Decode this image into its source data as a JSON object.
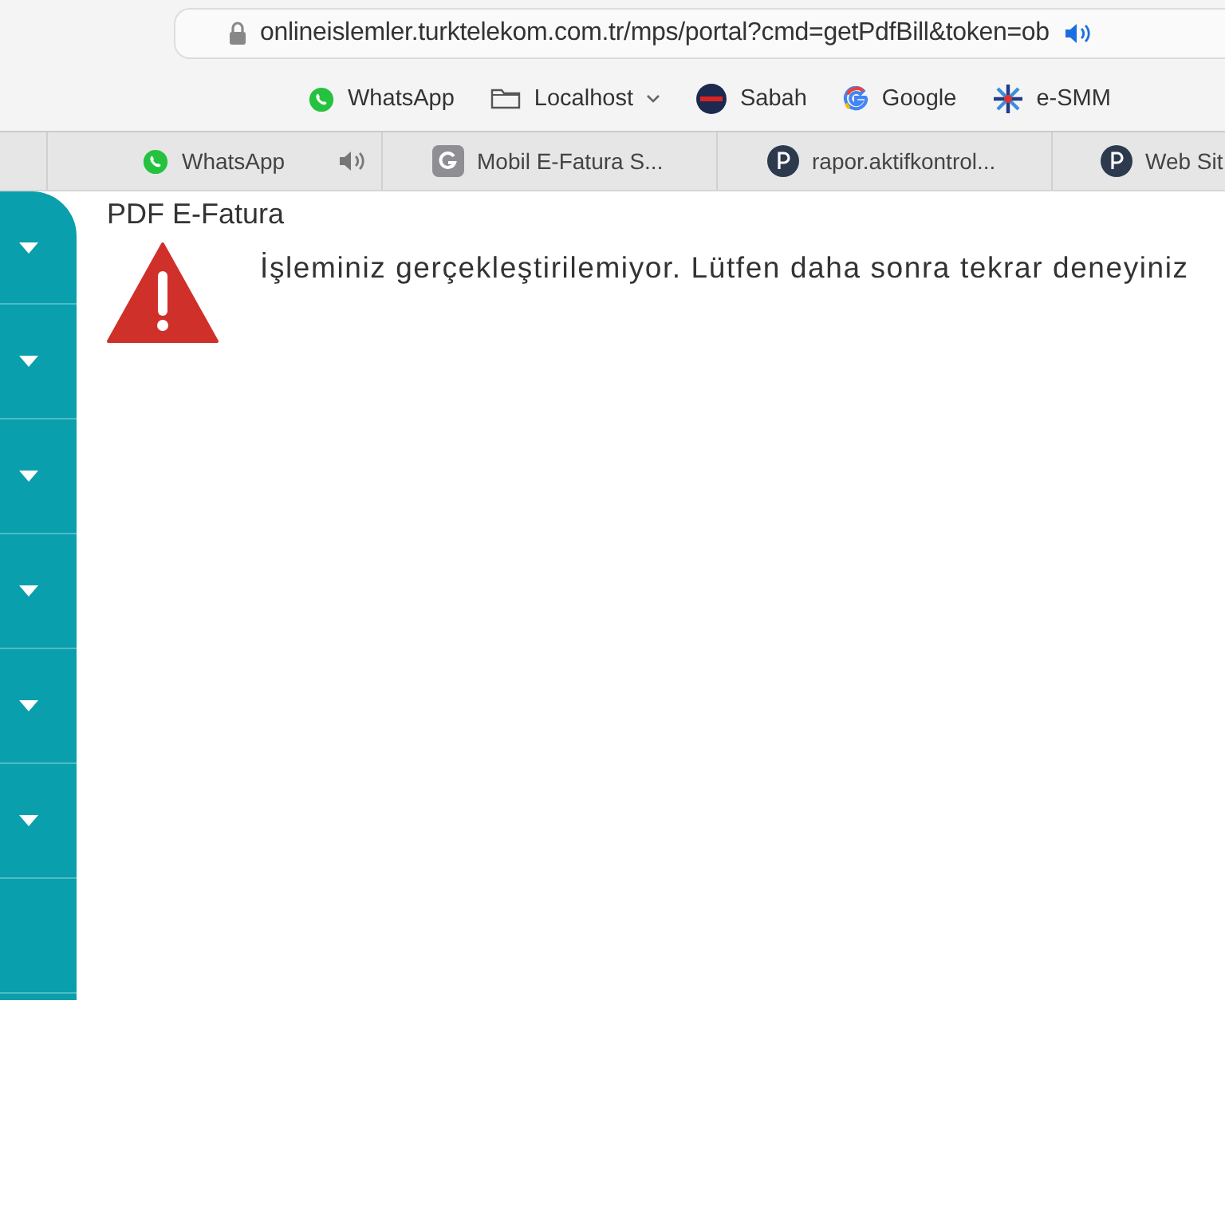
{
  "address_bar": {
    "url": "onlineislemler.turktelekom.com.tr/mps/portal?cmd=getPdfBill&token=ob"
  },
  "bookmarks": [
    {
      "label": "WhatsApp",
      "kind": "whatsapp"
    },
    {
      "label": "Localhost",
      "kind": "folder"
    },
    {
      "label": "Sabah",
      "kind": "sabah"
    },
    {
      "label": "Google",
      "kind": "google"
    },
    {
      "label": "e-SMM",
      "kind": "esmm"
    }
  ],
  "tabs": [
    {
      "label": "WhatsApp",
      "kind": "whatsapp",
      "selected": false,
      "audio": true
    },
    {
      "label": "Mobil E-Fatura S...",
      "kind": "g",
      "selected": false,
      "audio": false
    },
    {
      "label": "rapor.aktifkontrol...",
      "kind": "p",
      "selected": false,
      "audio": false
    },
    {
      "label": "Web Sit",
      "kind": "p",
      "selected": false,
      "audio": false
    }
  ],
  "sidebar": {
    "items": [
      {
        "kind": "menu"
      },
      {
        "kind": "menu"
      },
      {
        "kind": "menu"
      },
      {
        "kind": "menu"
      },
      {
        "kind": "menu"
      },
      {
        "kind": "menu"
      },
      {
        "kind": "blank"
      }
    ]
  },
  "content": {
    "title": "PDF E-Fatura",
    "message": "İşleminiz gerçekleştirilemiyor. Lütfen daha sonra tekrar deneyiniz"
  }
}
